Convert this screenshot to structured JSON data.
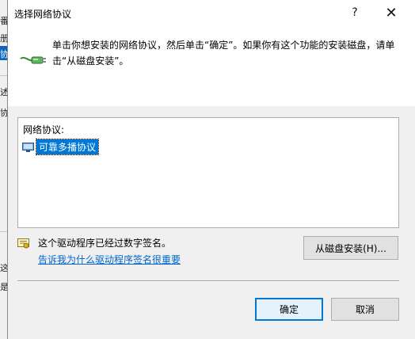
{
  "background_window": {
    "fragments": [
      "番",
      "册",
      "协",
      "述",
      "协",
      "这",
      "是"
    ]
  },
  "dialog": {
    "title": "选择网络协议",
    "help_glyph": "?",
    "close_glyph": "✕",
    "instruction": "单击你想安装的网络协议，然后单击“确定”。如果你有这个功能的安装磁盘，请单击“从磁盘安装”。",
    "list": {
      "header": "网络协议:",
      "items": [
        {
          "label": "可靠多播协议",
          "icon": "network-protocol-icon",
          "selected": true
        }
      ]
    },
    "signature": {
      "icon": "certificate-icon",
      "text": "这个驱动程序已经过数字签名。",
      "link": "告诉我为什么驱动程序签名很重要"
    },
    "buttons": {
      "have_disk": "从磁盘安装(H)...",
      "ok": "确定",
      "cancel": "取消"
    }
  },
  "colors": {
    "accent": "#0078d7",
    "link": "#0066cc"
  }
}
